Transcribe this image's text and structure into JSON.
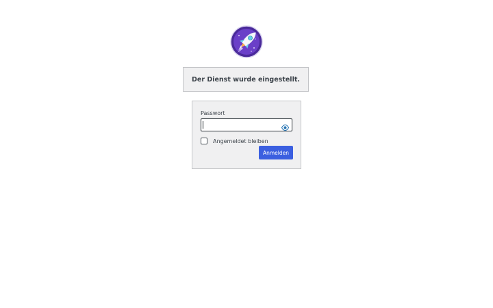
{
  "logo": {
    "icon": "rocket-icon",
    "colors": {
      "ring": "#4a2a9a",
      "fill": "#6a3fc8"
    }
  },
  "notice": {
    "text": "Der Dienst wurde eingestellt."
  },
  "login": {
    "password_label": "Passwort",
    "password_value": "",
    "toggle_icon": "eye-icon",
    "remember_label": "Angemeldet bleiben",
    "remember_checked": false,
    "submit_label": "Anmelden"
  },
  "colors": {
    "accent": "#3b5fe0",
    "panel": "#f0f0f1",
    "border": "#c3c4c7"
  }
}
